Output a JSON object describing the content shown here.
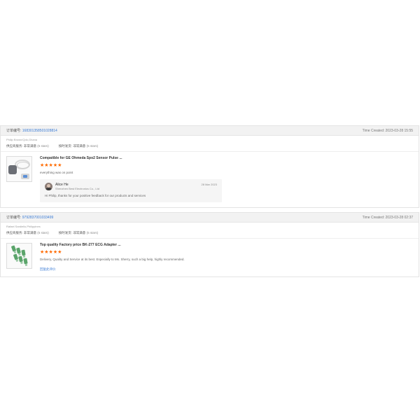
{
  "orders": [
    {
      "order_label": "订单编号:",
      "order_number": "168301358501028814",
      "time_created": "Time Created: 2023-03-28 15:55",
      "buyer": "Philip Brown/Qdo,Ghana",
      "supplier_service_label": "供应商服务:",
      "supplier_service_value": "非常满意",
      "supplier_service_stars": "(5 stars)",
      "delivery_label": "按时发货:",
      "delivery_value": "非常满意",
      "delivery_stars": "(5 stars)",
      "product_title": "Compatible for GE Ohmeda Spo2 Sensor Pulse ...",
      "stars": "★★★★★",
      "review": "everything was on point",
      "reply": {
        "name": "Alice He",
        "company": "Shenzhen Best Electronics Co., Ltd",
        "date": "28 Mar 2023",
        "text": "Hi Philip, thanks for your positive feedback for our products and services"
      }
    },
    {
      "order_label": "订单编号:",
      "order_number": "9792837001033499",
      "time_created": "Time Created: 2023-03-28 02:37",
      "buyer": "Rafael Sardiello,Philippines",
      "supplier_service_label": "供应商服务:",
      "supplier_service_value": "非常满意",
      "supplier_service_stars": "(5 stars)",
      "delivery_label": "按时发货:",
      "delivery_value": "非常满意",
      "delivery_stars": "(5 stars)",
      "product_title": "Top quality Factory price BK-277 ECG Adapter ...",
      "stars": "★★★★★",
      "review": "Delivery, Quality and Service at its best. Especially to Ms. Sherry, such a big help, highly recommended.",
      "add_review_link": "回复此评价"
    }
  ],
  "colors": {
    "accent_link": "#3a7bd5",
    "star": "#ff6a00",
    "header_bg": "#f2f2f2"
  }
}
